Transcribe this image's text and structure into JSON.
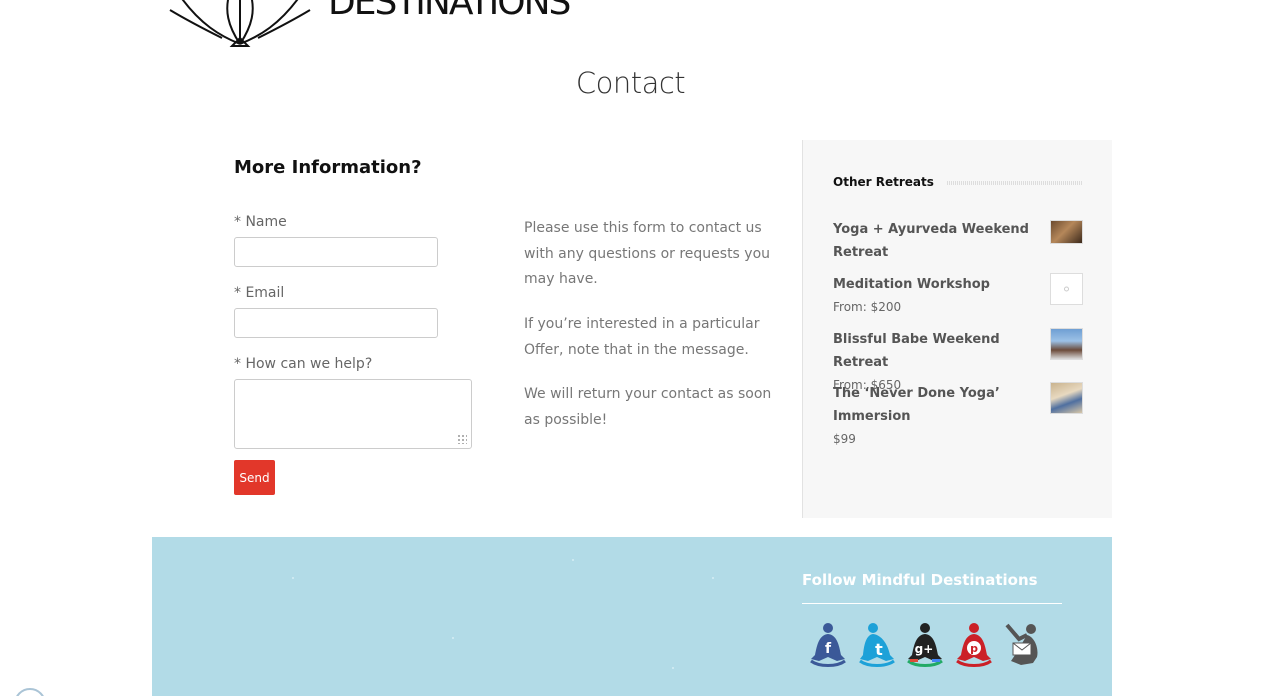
{
  "header": {
    "logo_text": "DESTINATIONS",
    "page_title": "Contact"
  },
  "form": {
    "heading": "More Information?",
    "name_label": "* Name",
    "name_value": "",
    "email_label": "* Email",
    "email_value": "",
    "help_label": "* How can we help?",
    "help_value": "",
    "send_label": "Send"
  },
  "info": {
    "paragraph_1": "Please use this form to contact us with any questions or requests you may have.",
    "paragraph_2": "If you’re interested in a particular Offer, note that in the message.",
    "paragraph_3": "We will return your contact as soon as possible!"
  },
  "sidebar": {
    "title": "Other Retreats",
    "items": [
      {
        "name": "Yoga + Ayurveda Weekend Retreat",
        "price": "",
        "thumb_icon": "retreat-photo-icon"
      },
      {
        "name": "Meditation Workshop",
        "price": "From: $200",
        "thumb_icon": "placeholder-icon"
      },
      {
        "name": "Blissful Babe Weekend Retreat",
        "price": "From: $650",
        "thumb_icon": "retreat-photo-icon"
      },
      {
        "name": "The ‘Never Done Yoga’ Immersion",
        "price": "$99",
        "thumb_icon": "retreat-photo-icon"
      }
    ]
  },
  "footer": {
    "follow_title": "Follow Mindful Destinations",
    "social": [
      {
        "icon": "facebook-icon",
        "color": "#3b5998"
      },
      {
        "icon": "twitter-icon",
        "color": "#1da1d8"
      },
      {
        "icon": "google-plus-icon",
        "color": "#222222"
      },
      {
        "icon": "pinterest-icon",
        "color": "#cb2027"
      },
      {
        "icon": "email-icon",
        "color": "#555555"
      }
    ]
  },
  "colors": {
    "accent": "#e2372a",
    "footer_bg": "#b2dbe7",
    "sidebar_bg": "#f7f7f7"
  }
}
